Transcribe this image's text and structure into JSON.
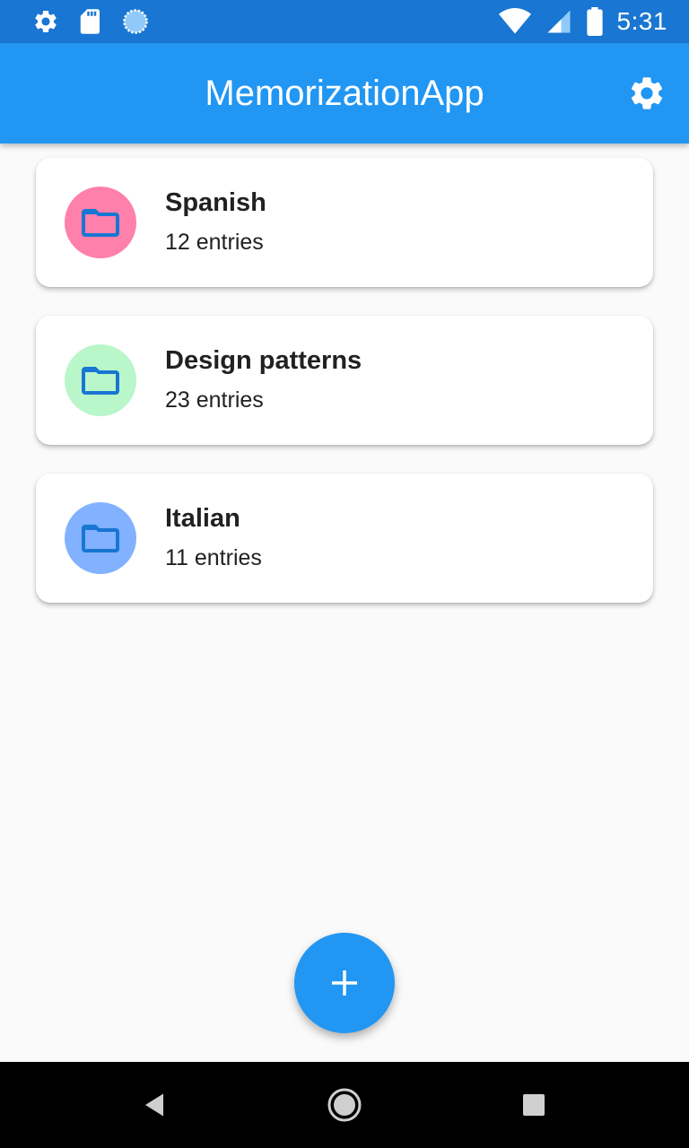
{
  "status_bar": {
    "time": "5:31",
    "left_icons": [
      "gear-icon",
      "sd-card-icon",
      "sync-icon"
    ],
    "right_icons": [
      "wifi-icon",
      "cell-signal-icon",
      "battery-icon"
    ]
  },
  "app_bar": {
    "title": "MemorizationApp",
    "settings_icon": "gear-icon"
  },
  "decks": [
    {
      "title": "Spanish",
      "subtitle": "12 entries",
      "avatar_color": "#ff80ab",
      "icon": "folder-icon"
    },
    {
      "title": "Design patterns",
      "subtitle": "23 entries",
      "avatar_color": "#b9f6ca",
      "icon": "folder-icon"
    },
    {
      "title": "Italian",
      "subtitle": "11 entries",
      "avatar_color": "#82b1ff",
      "icon": "folder-icon"
    }
  ],
  "fab": {
    "icon": "plus-icon",
    "color": "#2196f3"
  },
  "colors": {
    "status_bar": "#1976d2",
    "app_bar": "#2196f3",
    "folder_icon": "#1976d2",
    "background": "#fafafa"
  },
  "nav_bar": {
    "buttons": [
      "back-icon",
      "home-icon",
      "recents-icon"
    ]
  }
}
